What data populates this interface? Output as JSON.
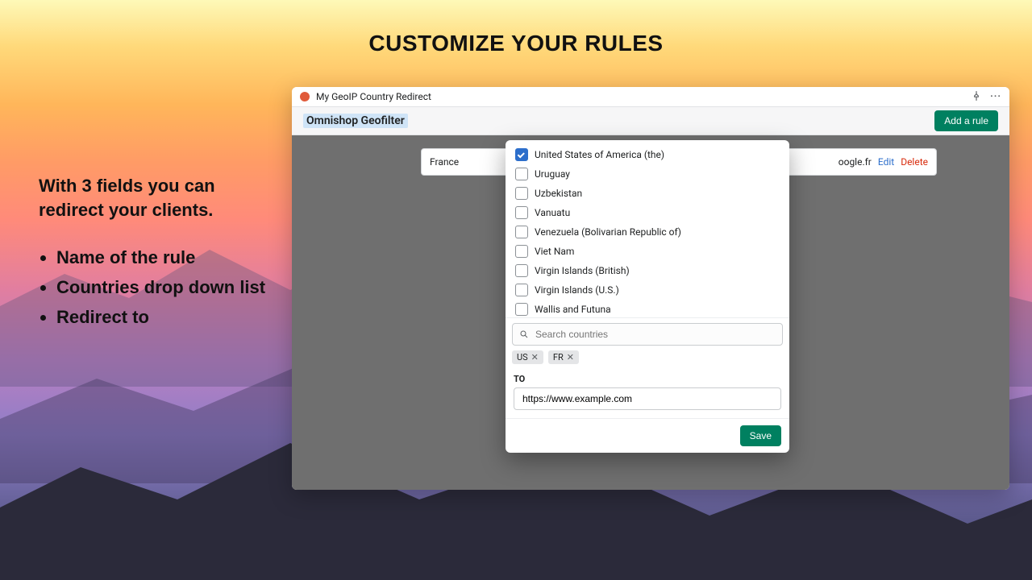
{
  "heading": "CUSTOMIZE YOUR RULES",
  "blurb": {
    "lead": "With 3 fields you can redirect your clients.",
    "items": [
      "Name of the rule",
      "Countries drop down list",
      "Redirect to"
    ]
  },
  "app": {
    "breadcrumb": "My GeoIP Country Redirect",
    "title": "Omnishop Geofilter",
    "add_rule_label": "Add a rule",
    "icons": {
      "pin": "pin-icon",
      "bell": "bell-icon",
      "more": "more-icon"
    }
  },
  "rule_row": {
    "name": "France",
    "destination_suffix": "oogle.fr",
    "edit_label": "Edit",
    "delete_label": "Delete"
  },
  "modal": {
    "countries": [
      {
        "label": "United States of America (the)",
        "checked": true
      },
      {
        "label": "Uruguay",
        "checked": false
      },
      {
        "label": "Uzbekistan",
        "checked": false
      },
      {
        "label": "Vanuatu",
        "checked": false
      },
      {
        "label": "Venezuela (Bolivarian Republic of)",
        "checked": false
      },
      {
        "label": "Viet Nam",
        "checked": false
      },
      {
        "label": "Virgin Islands (British)",
        "checked": false
      },
      {
        "label": "Virgin Islands (U.S.)",
        "checked": false
      },
      {
        "label": "Wallis and Futuna",
        "checked": false
      }
    ],
    "search_placeholder": "Search countries",
    "chips": [
      "US",
      "FR"
    ],
    "to_label": "TO",
    "url_value": "https://www.example.com",
    "save_label": "Save"
  }
}
